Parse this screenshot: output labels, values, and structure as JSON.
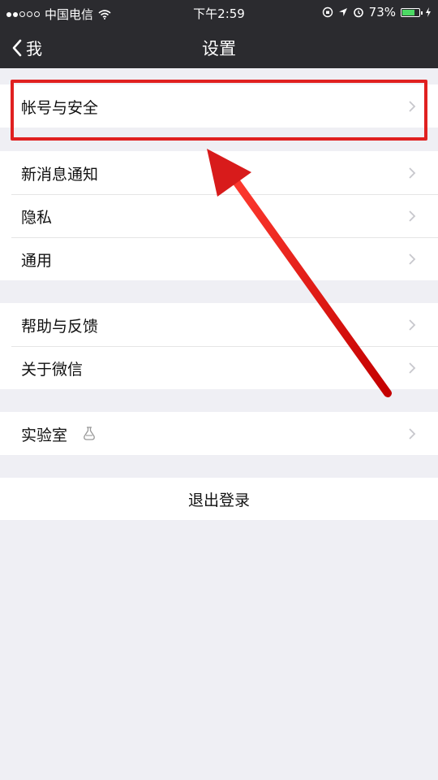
{
  "status_bar": {
    "carrier": "中国电信",
    "time": "下午2:59",
    "battery_percent": "73%",
    "battery_level": 0.73,
    "wifi_icon": "wifi-icon",
    "location_icon": "location-icon",
    "alarm_icon": "alarm-icon",
    "charging_icon": "charging-icon"
  },
  "nav": {
    "back_label": "我",
    "title": "设置"
  },
  "settings": {
    "account_security": "帐号与安全",
    "new_message_notification": "新消息通知",
    "privacy": "隐私",
    "general": "通用",
    "help_feedback": "帮助与反馈",
    "about_wechat": "关于微信",
    "lab": "实验室",
    "logout": "退出登录"
  },
  "annotation": {
    "highlight_color": "#e02020"
  },
  "colors": {
    "nav_background": "#2b2b2f",
    "page_background": "#efeff4",
    "cell_background": "#ffffff",
    "chevron": "#c7c7cc"
  }
}
